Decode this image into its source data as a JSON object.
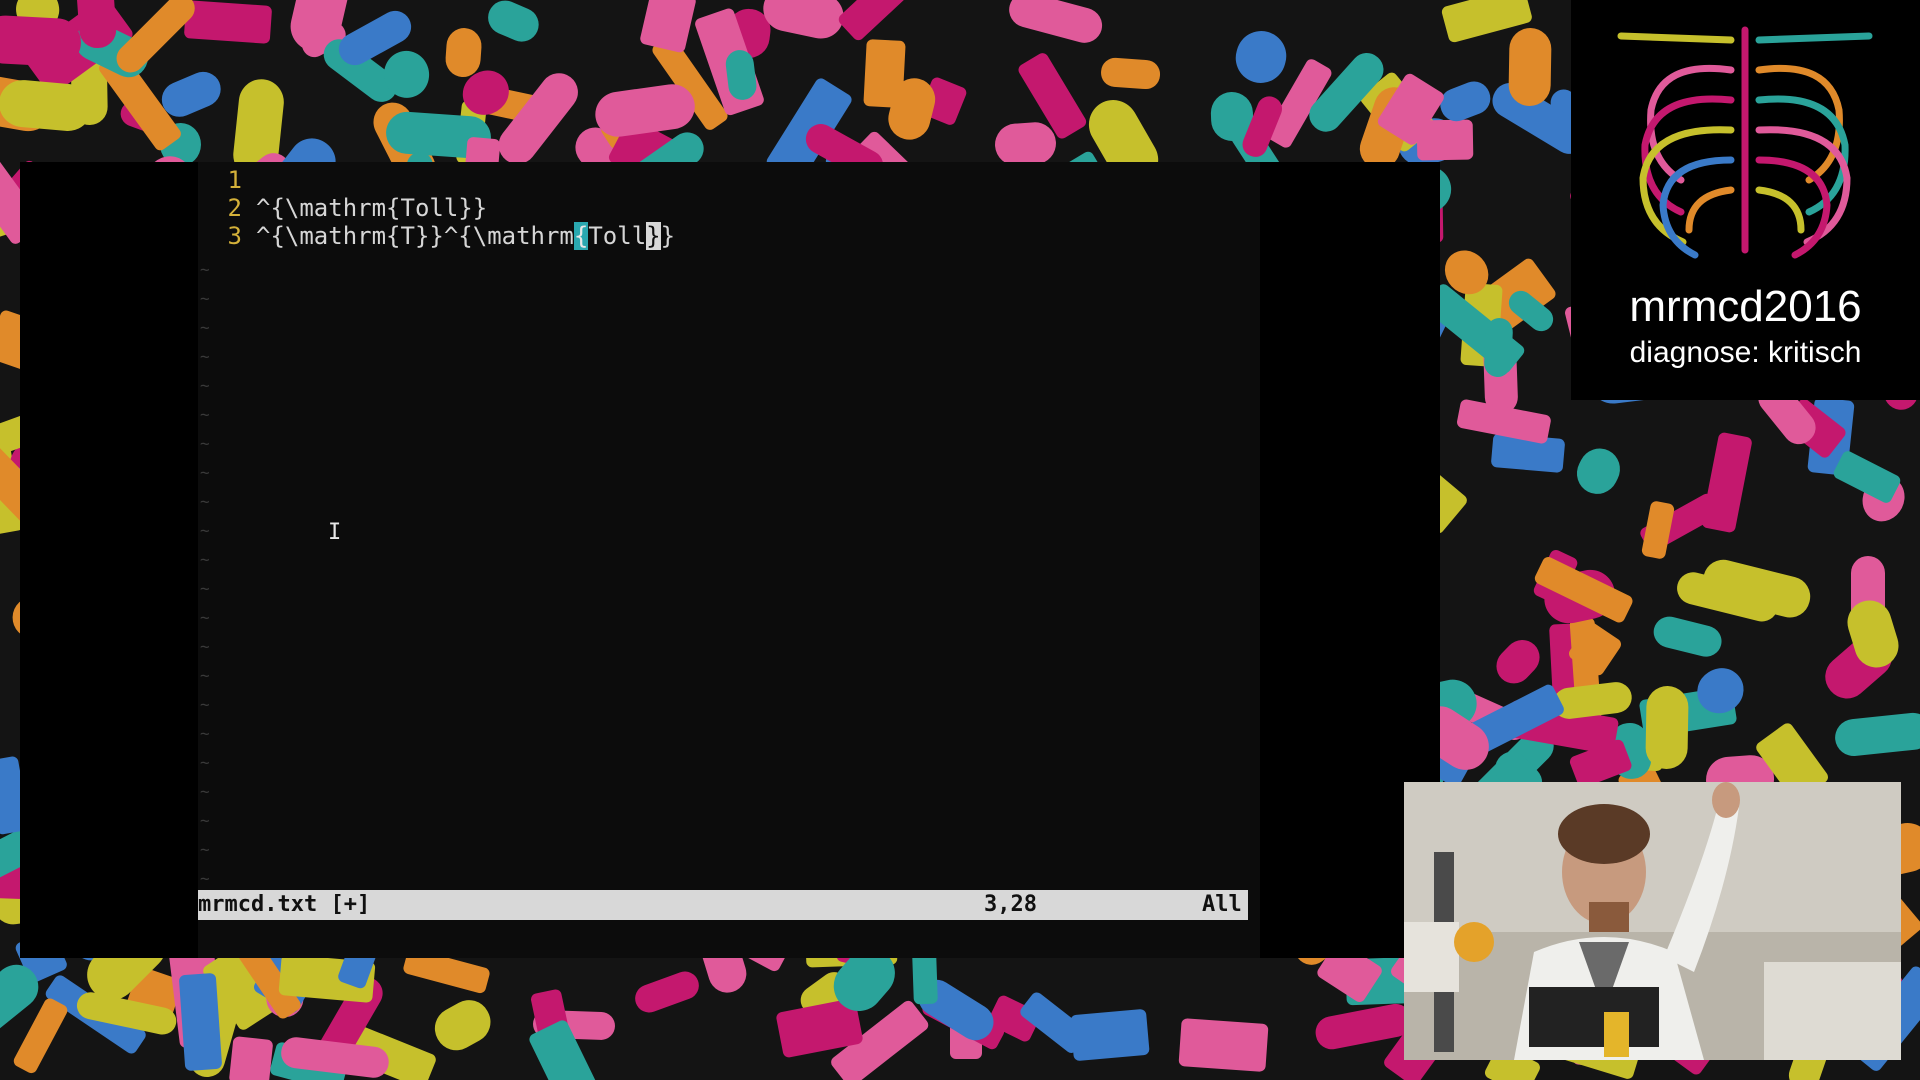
{
  "editor": {
    "lines": [
      {
        "num": "1",
        "text": ""
      },
      {
        "num": "2",
        "text": "^{\\mathrm{Toll}}"
      },
      {
        "num": "3",
        "pre": "^{\\mathrm{T}}^{\\mathrm",
        "hl_open": "{",
        "mid": "Toll",
        "cursor_char": "}",
        "post": "}"
      }
    ],
    "tilde_char": "~",
    "status": {
      "filename": "mrmcd.txt [+]",
      "position": "3,28",
      "scroll": "All"
    }
  },
  "event": {
    "name": "mrmcd2016",
    "subtitle": "diagnose: kritisch"
  },
  "colors": {
    "line_number": "#d4b13a",
    "match_highlight": "#2aa8b0",
    "status_bg": "#d8d8d8",
    "pill_palette": [
      "#c4186e",
      "#e08a2a",
      "#c6c02c",
      "#2aa39a",
      "#e05a9a",
      "#3a7ac8"
    ]
  },
  "icons": {
    "text_cursor": "i-beam-icon",
    "logo": "ribcage-icon"
  }
}
